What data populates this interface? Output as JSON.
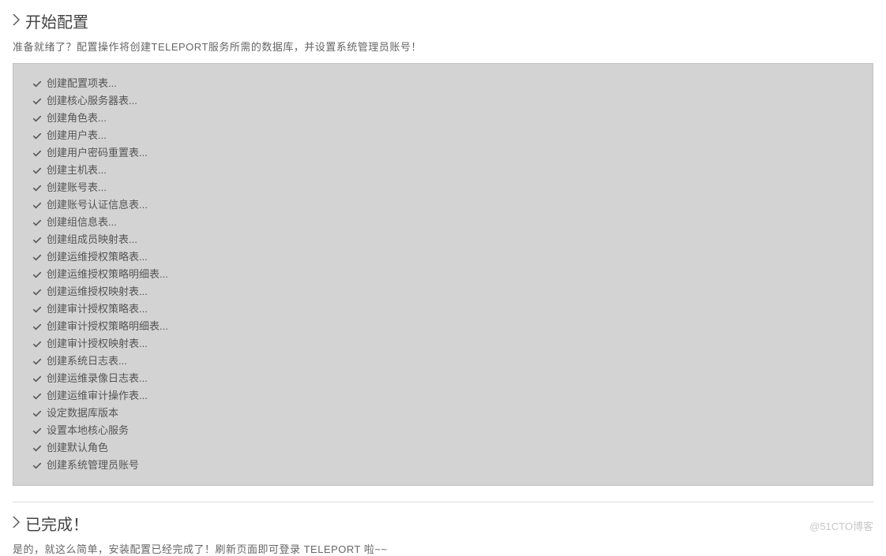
{
  "section_start": {
    "title": "开始配置",
    "description": "准备就绪了？配置操作将创建TELEPORT服务所需的数据库，并设置系统管理员账号！"
  },
  "log_items": [
    "创建配置项表...",
    "创建核心服务器表...",
    "创建角色表...",
    "创建用户表...",
    "创建用户密码重置表...",
    "创建主机表...",
    "创建账号表...",
    "创建账号认证信息表...",
    "创建组信息表...",
    "创建组成员映射表...",
    "创建运维授权策略表...",
    "创建运维授权策略明细表...",
    "创建运维授权映射表...",
    "创建审计授权策略表...",
    "创建审计授权策略明细表...",
    "创建审计授权映射表...",
    "创建系统日志表...",
    "创建运维录像日志表...",
    "创建运维审计操作表...",
    "设定数据库版本",
    "设置本地核心服务",
    "创建默认角色",
    "创建系统管理员账号"
  ],
  "section_done": {
    "title": "已完成！",
    "description": "是的，就这么简单，安装配置已经完成了！刷新页面即可登录 TELEPORT 啦~~"
  },
  "watermark": "@51CTO博客"
}
